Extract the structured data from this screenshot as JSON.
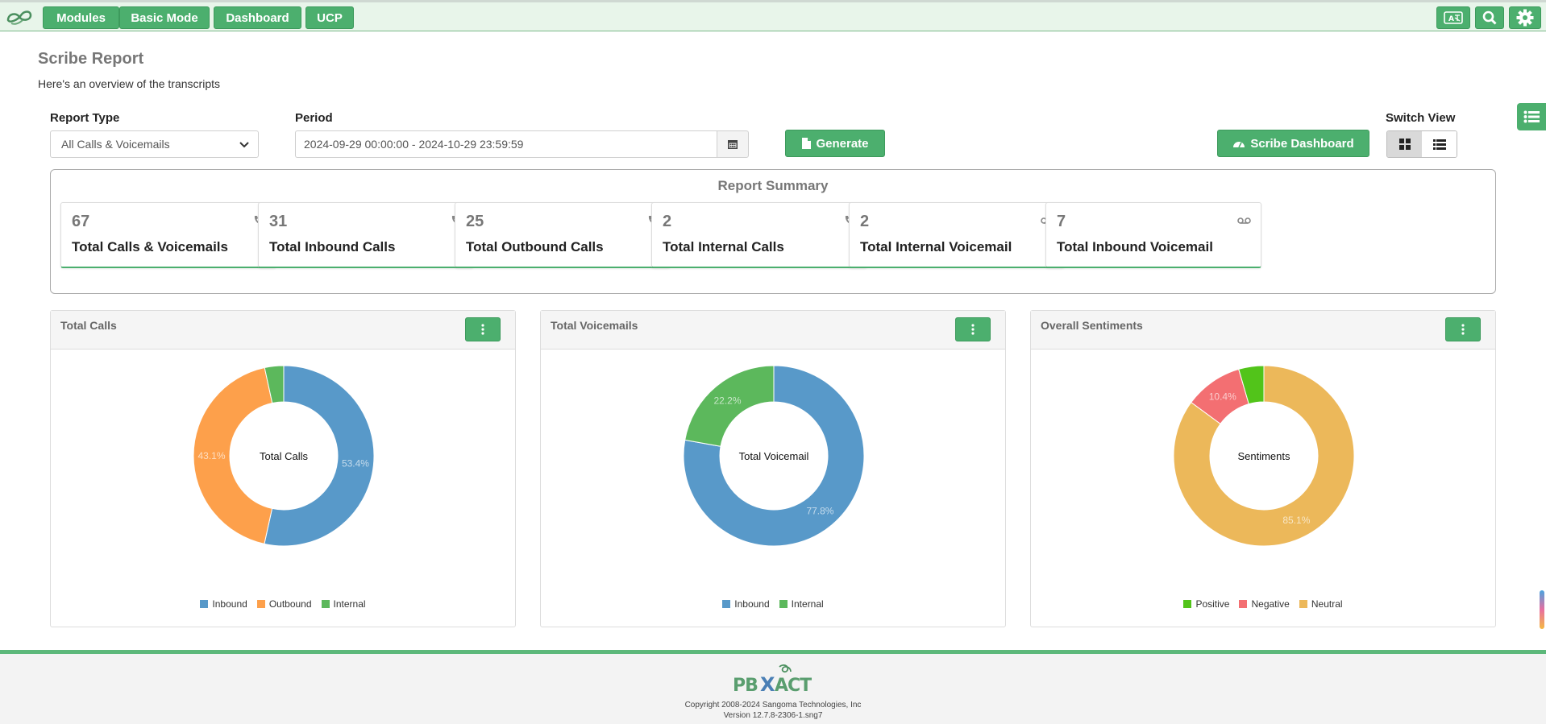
{
  "nav": {
    "modules": "Modules",
    "basic_mode": "Basic Mode",
    "dashboard": "Dashboard",
    "ucp": "UCP"
  },
  "page": {
    "title": "Scribe Report",
    "subtitle": "Here's an overview of the transcripts"
  },
  "filters": {
    "report_type_label": "Report Type",
    "report_type_value": "All Calls & Voicemails",
    "period_label": "Period",
    "period_value": "2024-09-29 00:00:00 - 2024-10-29 23:59:59",
    "generate_label": "Generate",
    "scribe_dashboard_label": "Scribe Dashboard",
    "switch_view_label": "Switch View"
  },
  "summary": {
    "title": "Report Summary",
    "cards": [
      {
        "value": "67",
        "label": "Total Calls & Voicemails",
        "icon": "phone-icon"
      },
      {
        "value": "31",
        "label": "Total Inbound Calls",
        "icon": "phone-incoming-icon"
      },
      {
        "value": "25",
        "label": "Total Outbound Calls",
        "icon": "phone-outgoing-icon"
      },
      {
        "value": "2",
        "label": "Total Internal Calls",
        "icon": "phone-internal-icon"
      },
      {
        "value": "2",
        "label": "Total Internal Voicemail",
        "icon": "voicemail-icon"
      },
      {
        "value": "7",
        "label": "Total Inbound Voicemail",
        "icon": "voicemail-icon"
      }
    ]
  },
  "chart_data": [
    {
      "type": "pie",
      "title": "Total Calls",
      "center_label": "Total Calls",
      "categories": [
        "Inbound",
        "Outbound",
        "Internal"
      ],
      "values": [
        53.4,
        43.1,
        3.4
      ],
      "labels": [
        "53.4%",
        "43.1%",
        ""
      ],
      "colors": [
        "#5899c9",
        "#fda04b",
        "#5cb85c"
      ],
      "start_angle": 0
    },
    {
      "type": "pie",
      "title": "Total Voicemails",
      "center_label": "Total Voicemail",
      "categories": [
        "Inbound",
        "Internal"
      ],
      "values": [
        77.8,
        22.2
      ],
      "labels": [
        "77.8%",
        "22.2%"
      ],
      "colors": [
        "#5899c9",
        "#5cb85c"
      ],
      "start_angle": 0
    },
    {
      "type": "pie",
      "title": "Overall Sentiments",
      "center_label": "Sentiments",
      "categories": [
        "Positive",
        "Negative",
        "Neutral"
      ],
      "values": [
        4.5,
        10.4,
        85.1
      ],
      "labels": [
        "",
        "10.4%",
        "85.1%"
      ],
      "colors": [
        "#52c41a",
        "#f36f72",
        "#ecb85a"
      ],
      "order": [
        2,
        1,
        0
      ],
      "start_angle": 0
    }
  ],
  "footer": {
    "copyright": "Copyright 2008-2024 Sangoma Technologies, Inc",
    "version": "Version 12.7.8-2306-1.sng7"
  }
}
